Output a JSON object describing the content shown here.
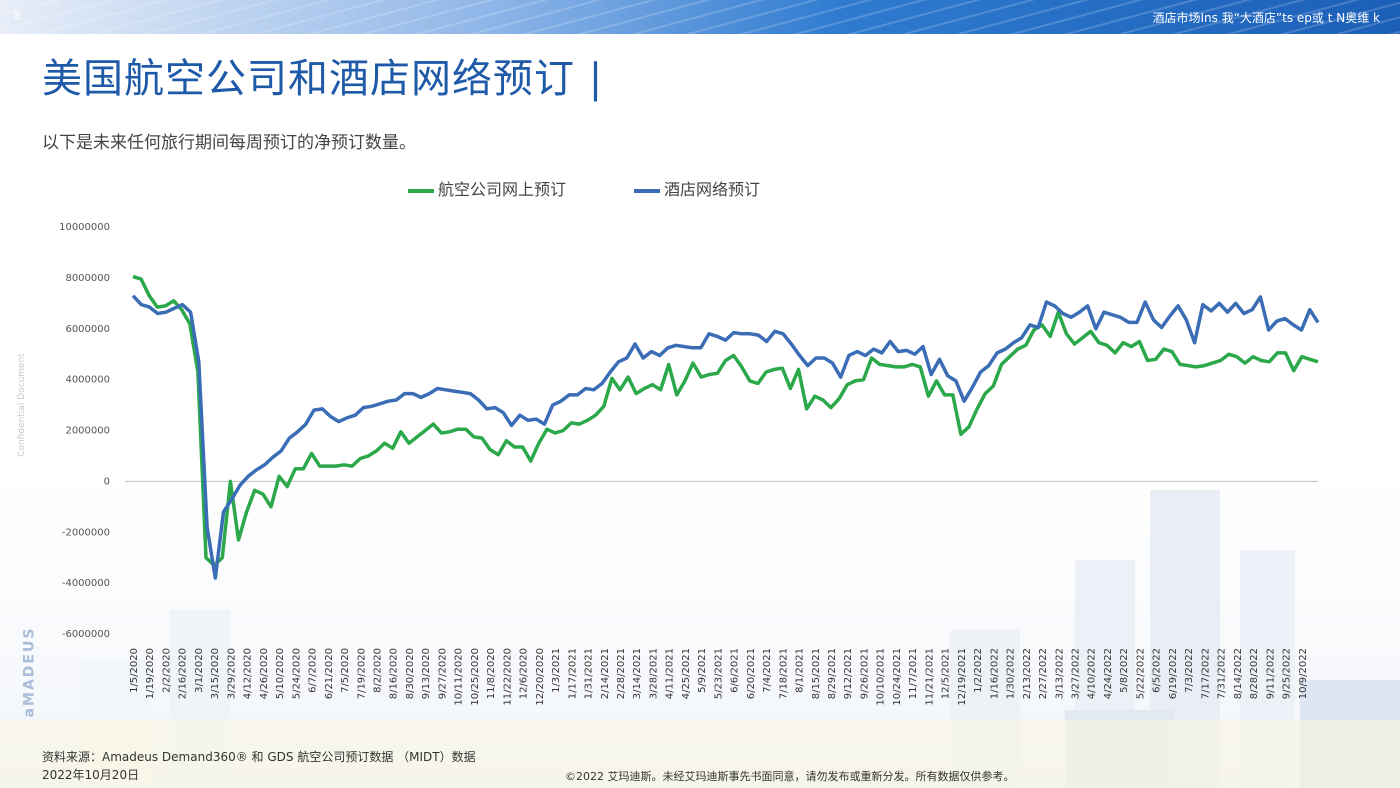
{
  "header": {
    "page_number": "8",
    "top_right": "酒店市场Ins 我“大酒店”ts ep或 t N奥维 k"
  },
  "title": "美国航空公司和酒店网络预订",
  "subtitle": "以下是未来任何旅行期间每周预订的净预订数量。",
  "side_label": "Confidential Document",
  "brand": "aMADEUS",
  "footer": {
    "source": "资料来源：Amadeus Demand360® 和 GDS 航空公司预订数据 （MIDT）数据",
    "date": "2022年10月20日",
    "copyright": "©2022 艾玛迪斯。未经艾玛迪斯事先书面同意，请勿发布或重新分发。所有数据仅供参考。"
  },
  "colors": {
    "airline": "#2aa84a",
    "hotel": "#3a6db5",
    "title": "#1e5aa8"
  },
  "chart_data": {
    "type": "line",
    "ylim": [
      -6000000,
      10000000
    ],
    "y_ticks": [
      -6000000,
      -4000000,
      -2000000,
      0,
      2000000,
      4000000,
      6000000,
      8000000,
      10000000
    ],
    "x_tick_labels": [
      "1/5/2020",
      "1/19/2020",
      "2/2/2020",
      "2/16/2020",
      "3/1/2020",
      "3/15/2020",
      "3/29/2020",
      "4/12/2020",
      "4/26/2020",
      "5/10/2020",
      "5/24/2020",
      "6/7/2020",
      "6/21/2020",
      "7/5/2020",
      "7/19/2020",
      "8/2/2020",
      "8/16/2020",
      "8/30/2020",
      "9/13/2020",
      "9/27/2020",
      "10/11/2020",
      "10/25/2020",
      "11/8/2020",
      "11/22/2020",
      "12/6/2020",
      "12/20/2020",
      "1/3/2021",
      "1/17/2021",
      "1/31/2021",
      "2/14/2021",
      "2/28/2021",
      "3/14/2021",
      "3/28/2021",
      "4/11/2021",
      "4/25/2021",
      "5/9/2021",
      "5/23/2021",
      "6/6/2021",
      "6/20/2021",
      "7/4/2021",
      "7/18/2021",
      "8/1/2021",
      "8/15/2021",
      "8/29/2021",
      "9/12/2021",
      "9/26/2021",
      "10/10/2021",
      "10/24/2021",
      "11/7/2021",
      "11/21/2021",
      "12/5/2021",
      "12/19/2021",
      "1/2/2022",
      "1/16/2022",
      "1/30/2022",
      "2/13/2022",
      "2/27/2022",
      "3/13/2022",
      "3/27/2022",
      "4/10/2022",
      "4/24/2022",
      "5/8/2022",
      "5/22/2022",
      "6/5/2022",
      "6/19/2022",
      "7/3/2022",
      "7/17/2022",
      "7/31/2022",
      "8/14/2022",
      "8/28/2022",
      "9/11/2022",
      "9/25/2022",
      "10/9/2022"
    ],
    "series": [
      {
        "name": "航空公司网上预订",
        "values": [
          8050000,
          7950000,
          7300000,
          6850000,
          6900000,
          7100000,
          6750000,
          6200000,
          4300000,
          -3000000,
          -3300000,
          -3000000,
          0,
          -2300000,
          -1200000,
          -350000,
          -500000,
          -1000000,
          200000,
          -200000,
          500000,
          500000,
          1100000,
          600000,
          600000,
          600000,
          650000,
          600000,
          900000,
          1000000,
          1200000,
          1500000,
          1300000,
          1950000,
          1500000,
          1750000,
          2000000,
          2250000,
          1900000,
          1950000,
          2050000,
          2050000,
          1750000,
          1700000,
          1250000,
          1050000,
          1600000,
          1350000,
          1350000,
          800000,
          1500000,
          2050000,
          1900000,
          2000000,
          2300000,
          2250000,
          2400000,
          2600000,
          2950000,
          4050000,
          3600000,
          4100000,
          3450000,
          3650000,
          3800000,
          3600000,
          4600000,
          3400000,
          3950000,
          4650000,
          4100000,
          4200000,
          4250000,
          4750000,
          4950000,
          4500000,
          3950000,
          3850000,
          4300000,
          4400000,
          4450000,
          3650000,
          4400000,
          2850000,
          3350000,
          3200000,
          2900000,
          3250000,
          3800000,
          3950000,
          4000000,
          4850000,
          4600000,
          4550000,
          4500000,
          4500000,
          4600000,
          4500000,
          3350000,
          3950000,
          3400000,
          3400000,
          1850000,
          2150000,
          2850000,
          3450000,
          3750000,
          4600000,
          4900000,
          5200000,
          5350000,
          5950000,
          6150000,
          5700000,
          6650000,
          5800000,
          5400000,
          5650000,
          5900000,
          5450000,
          5350000,
          5050000,
          5450000,
          5300000,
          5500000,
          4750000,
          4800000,
          5200000,
          5100000,
          4600000,
          4550000,
          4500000,
          4550000,
          4650000,
          4750000,
          5000000,
          4900000,
          4650000,
          4900000,
          4750000,
          4700000,
          5050000,
          5050000,
          4350000,
          4900000,
          4800000,
          4700000
        ]
      },
      {
        "name": "酒店网络预订",
        "values": [
          7300000,
          6950000,
          6850000,
          6600000,
          6650000,
          6800000,
          6950000,
          6650000,
          4700000,
          -1800000,
          -3800000,
          -1200000,
          -700000,
          -150000,
          200000,
          450000,
          650000,
          950000,
          1200000,
          1700000,
          1950000,
          2250000,
          2800000,
          2850000,
          2550000,
          2350000,
          2500000,
          2600000,
          2900000,
          2950000,
          3050000,
          3150000,
          3200000,
          3450000,
          3450000,
          3300000,
          3450000,
          3650000,
          3600000,
          3550000,
          3500000,
          3450000,
          3200000,
          2850000,
          2900000,
          2700000,
          2200000,
          2600000,
          2400000,
          2450000,
          2250000,
          3000000,
          3150000,
          3400000,
          3400000,
          3650000,
          3600000,
          3850000,
          4300000,
          4700000,
          4850000,
          5400000,
          4850000,
          5100000,
          4950000,
          5250000,
          5350000,
          5300000,
          5250000,
          5250000,
          5800000,
          5700000,
          5550000,
          5850000,
          5800000,
          5800000,
          5750000,
          5500000,
          5900000,
          5800000,
          5400000,
          4950000,
          4550000,
          4850000,
          4850000,
          4650000,
          4100000,
          4950000,
          5100000,
          4950000,
          5200000,
          5050000,
          5500000,
          5100000,
          5150000,
          5000000,
          5300000,
          4200000,
          4800000,
          4150000,
          3950000,
          3150000,
          3700000,
          4300000,
          4550000,
          5050000,
          5200000,
          5450000,
          5650000,
          6150000,
          6050000,
          7050000,
          6900000,
          6600000,
          6450000,
          6650000,
          6900000,
          6000000,
          6650000,
          6550000,
          6450000,
          6250000,
          6250000,
          7050000,
          6350000,
          6050000,
          6500000,
          6900000,
          6350000,
          5450000,
          6950000,
          6700000,
          7000000,
          6650000,
          7000000,
          6600000,
          6750000,
          7250000,
          5950000,
          6300000,
          6400000,
          6150000,
          5950000,
          6750000,
          6250000
        ]
      }
    ]
  }
}
